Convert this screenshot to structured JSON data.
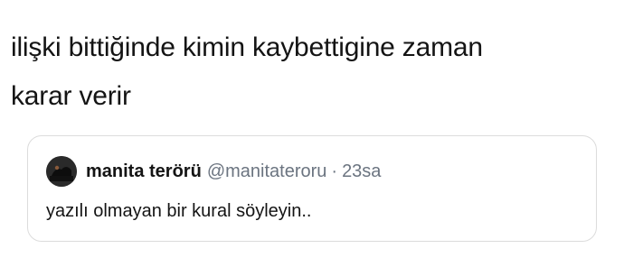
{
  "tweet": {
    "text_line1": "ilişki bittiğinde kimin kaybettigine zaman",
    "text_line2": "karar verir"
  },
  "quote": {
    "avatar_icon": "profile-avatar-icon",
    "display_name": "manita terörü",
    "handle": "@manitateroru",
    "separator": "·",
    "time": "23sa",
    "text": "yazılı olmayan bir kural söyleyin.."
  },
  "colors": {
    "text": "#141414",
    "muted": "#6b7480",
    "border": "#dcdcdc",
    "background": "#ffffff"
  }
}
